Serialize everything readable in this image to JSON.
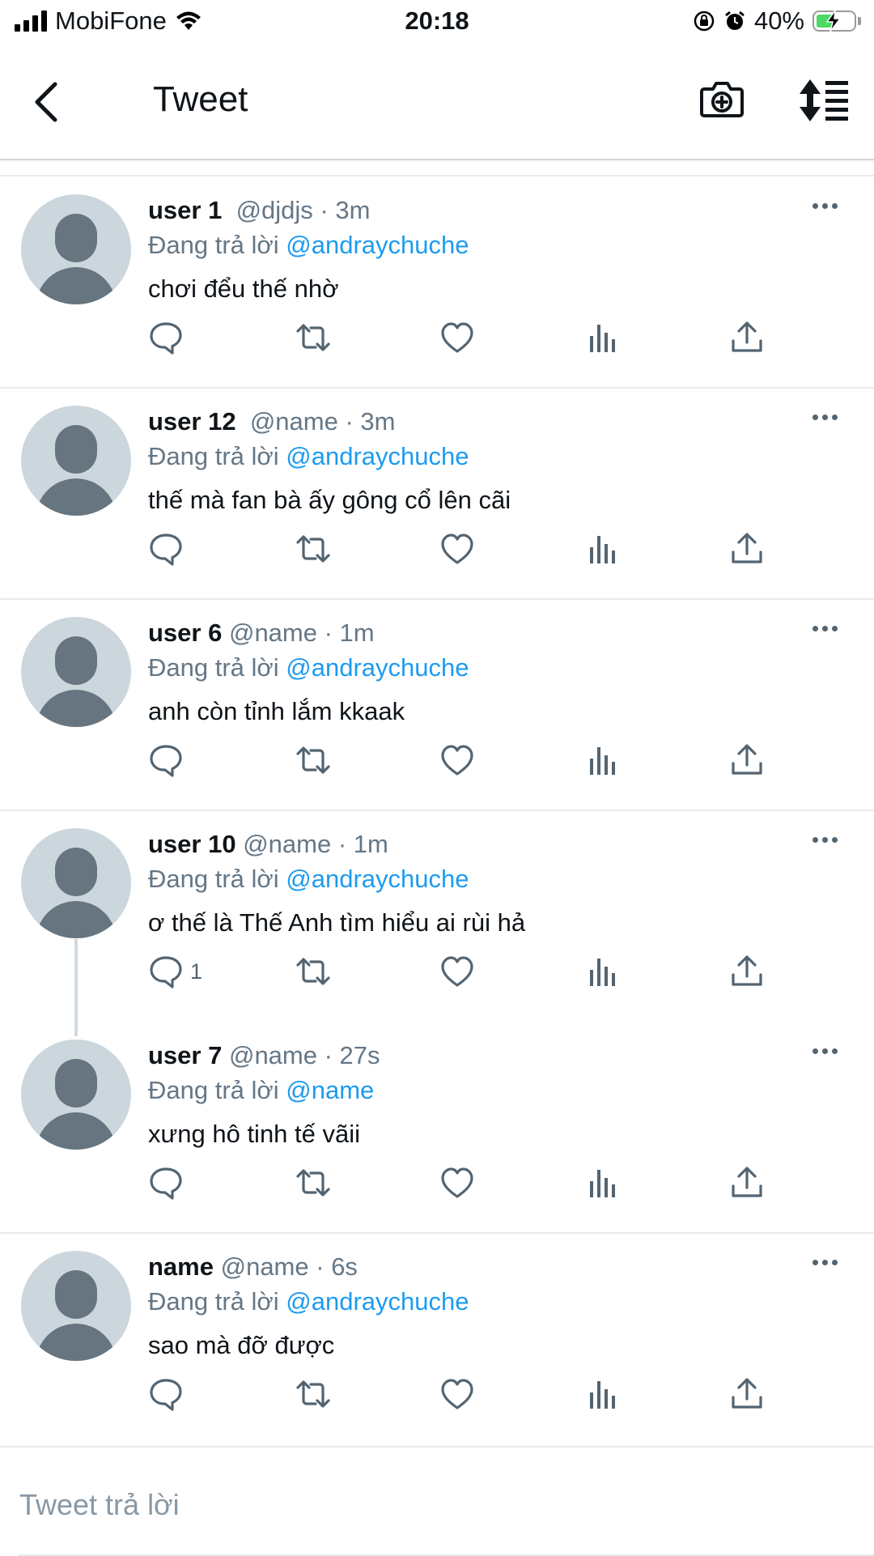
{
  "status_bar": {
    "carrier": "MobiFone",
    "time": "20:18",
    "battery_percent": "40%"
  },
  "header": {
    "title": "Tweet"
  },
  "tweets": [
    {
      "name": "user 1",
      "handle": "@djdjs",
      "time": "3m",
      "replying_prefix": "Đang trả lời",
      "mention": "@andraychuche",
      "text": "chơi đểu thế nhờ",
      "reply_count": ""
    },
    {
      "name": "user 12",
      "handle": "@name",
      "time": "3m",
      "replying_prefix": "Đang trả lời",
      "mention": "@andraychuche",
      "text": "thế mà fan bà ấy gông cổ lên cãi",
      "reply_count": ""
    },
    {
      "name": "user 6",
      "handle": "@name",
      "time": "1m",
      "replying_prefix": "Đang trả lời",
      "mention": "@andraychuche",
      "text": "anh còn tỉnh lắm kkaak",
      "reply_count": ""
    },
    {
      "name": "user 10",
      "handle": "@name",
      "time": "1m",
      "replying_prefix": "Đang trả lời",
      "mention": "@andraychuche",
      "text": "ơ thế là Thế Anh tìm hiểu ai rùi hả",
      "reply_count": "1"
    },
    {
      "name": "user 7",
      "handle": "@name",
      "time": "27s",
      "replying_prefix": "Đang trả lời",
      "mention": "@name",
      "text": "xưng hô tinh tế vãii",
      "reply_count": ""
    },
    {
      "name": "name",
      "handle": "@name",
      "time": "6s",
      "replying_prefix": "Đang trả lời",
      "mention": "@andraychuche",
      "text": "sao mà đỡ được",
      "reply_count": ""
    }
  ],
  "reply_box": {
    "placeholder": "Tweet trả lời"
  },
  "colors": {
    "accent": "#1d9bf0",
    "secondary_text": "#657786",
    "avatar_bg": "#ccd6dd",
    "avatar_fg": "#66757f",
    "battery_fill": "#4cd964"
  },
  "icons": [
    "back-icon",
    "camera-plus-icon",
    "sort-icon",
    "reply-icon",
    "retweet-icon",
    "like-icon",
    "analytics-icon",
    "share-icon",
    "more-icon"
  ]
}
